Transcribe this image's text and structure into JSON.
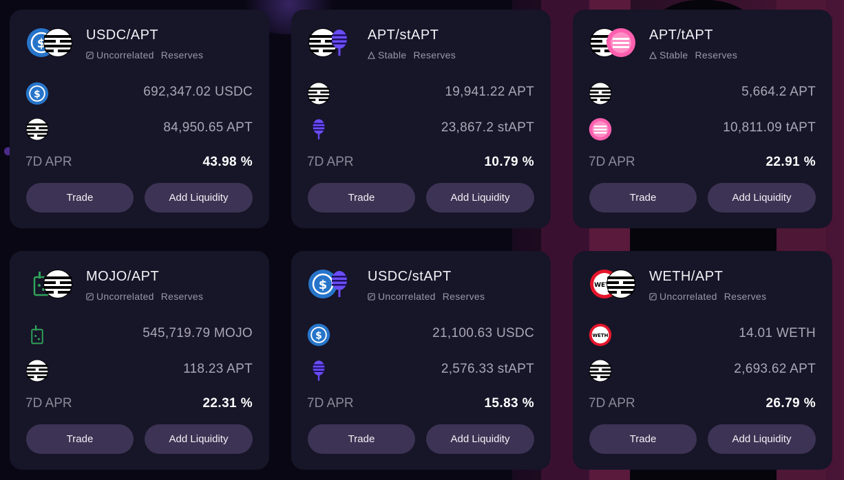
{
  "labels": {
    "apr": "7D APR",
    "trade": "Trade",
    "add_liquidity": "Add Liquidity",
    "reserves": "Reserves"
  },
  "pools": [
    {
      "pair": "USDC/APT",
      "type": "Uncorrelated",
      "type_icon": "uncorrelated-icon",
      "tokens": [
        {
          "amount": "692,347.02 USDC",
          "icon": "usdc-icon"
        },
        {
          "amount": "84,950.65 APT",
          "icon": "apt-icon"
        }
      ],
      "apr": "43.98 %"
    },
    {
      "pair": "APT/stAPT",
      "type": "Stable",
      "type_icon": "stable-icon",
      "tokens": [
        {
          "amount": "19,941.22 APT",
          "icon": "apt-icon"
        },
        {
          "amount": "23,867.2 stAPT",
          "icon": "stapt-icon"
        }
      ],
      "apr": "10.79 %"
    },
    {
      "pair": "APT/tAPT",
      "type": "Stable",
      "type_icon": "stable-icon",
      "tokens": [
        {
          "amount": "5,664.2 APT",
          "icon": "apt-icon"
        },
        {
          "amount": "10,811.09 tAPT",
          "icon": "tapt-icon"
        }
      ],
      "apr": "22.91 %"
    },
    {
      "pair": "MOJO/APT",
      "type": "Uncorrelated",
      "type_icon": "uncorrelated-icon",
      "tokens": [
        {
          "amount": "545,719.79 MOJO",
          "icon": "mojo-icon"
        },
        {
          "amount": "118.23 APT",
          "icon": "apt-icon"
        }
      ],
      "apr": "22.31 %"
    },
    {
      "pair": "USDC/stAPT",
      "type": "Uncorrelated",
      "type_icon": "uncorrelated-icon",
      "tokens": [
        {
          "amount": "21,100.63 USDC",
          "icon": "usdc-icon"
        },
        {
          "amount": "2,576.33 stAPT",
          "icon": "stapt-icon"
        }
      ],
      "apr": "15.83 %"
    },
    {
      "pair": "WETH/APT",
      "type": "Uncorrelated",
      "type_icon": "uncorrelated-icon",
      "tokens": [
        {
          "amount": "14.01 WETH",
          "icon": "weth-icon"
        },
        {
          "amount": "2,693.62 APT",
          "icon": "apt-icon"
        }
      ],
      "apr": "26.79 %"
    }
  ],
  "colors": {
    "card_bg": "#171528",
    "button_bg": "#3d3354",
    "usdc": "#2775ca",
    "stapt": "#5b3df5",
    "tapt": "#ff4fa3",
    "mojo": "#2fa35a",
    "weth": "#e5152a"
  }
}
